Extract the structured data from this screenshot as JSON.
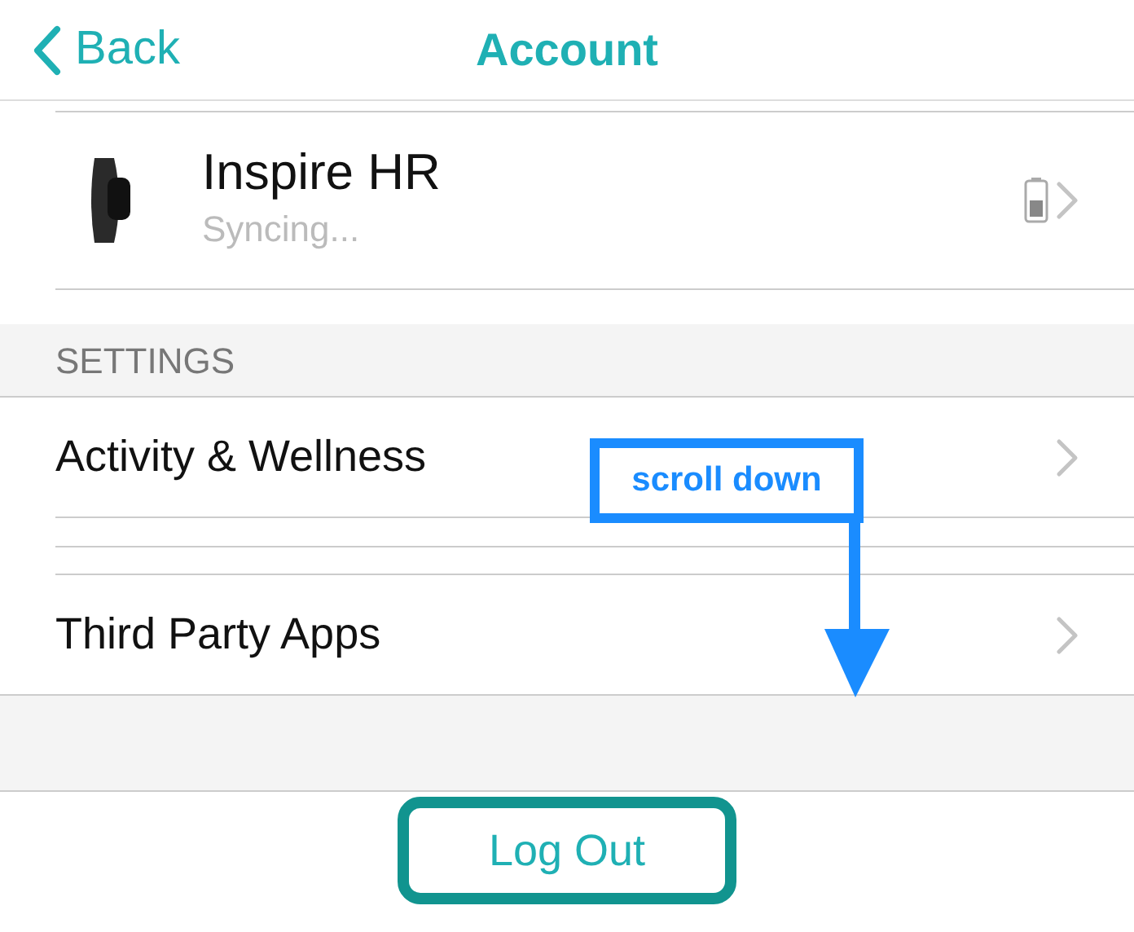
{
  "nav": {
    "back": "Back",
    "title": "Account"
  },
  "device": {
    "name": "Inspire HR",
    "status": "Syncing..."
  },
  "settings": {
    "header": "SETTINGS",
    "items": [
      {
        "label": "Activity & Wellness"
      },
      {
        "label": "Third Party Apps"
      }
    ]
  },
  "annotation": {
    "text": "scroll down"
  },
  "logout": {
    "label": "Log Out",
    "highlighted": true
  }
}
